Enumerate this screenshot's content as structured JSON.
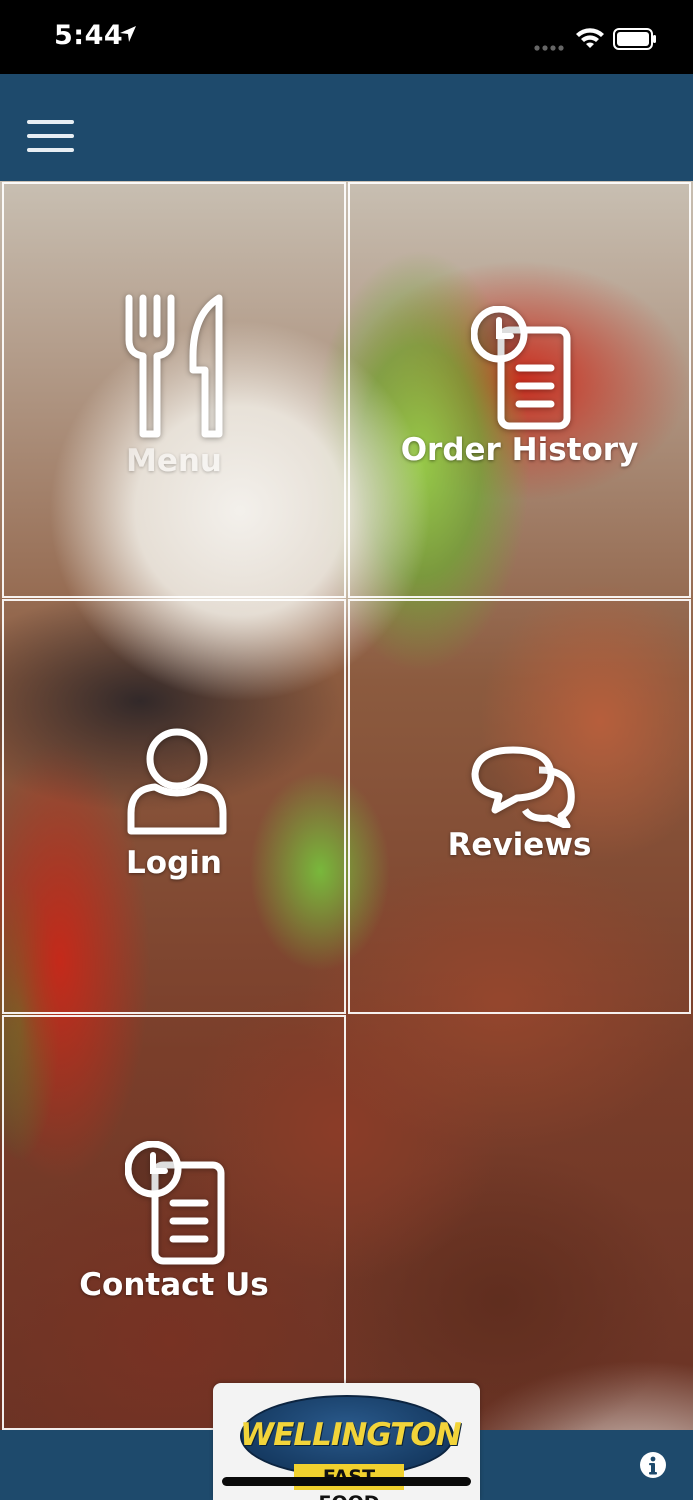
{
  "status_bar": {
    "time": "5:44"
  },
  "header": {
    "menu_icon": "hamburger-icon"
  },
  "tiles": [
    {
      "label": "Menu",
      "icon": "fork-knife-icon"
    },
    {
      "label": "Order History",
      "icon": "clock-document-icon"
    },
    {
      "label": "Login",
      "icon": "user-icon"
    },
    {
      "label": "Reviews",
      "icon": "chat-bubbles-icon"
    },
    {
      "label": "Contact Us",
      "icon": "clock-document-icon"
    }
  ],
  "footer": {
    "logo": {
      "name": "WELLINGTON",
      "sub": "FAST FOOD"
    },
    "info_icon": "info-icon"
  },
  "colors": {
    "nav_bar": "#1e4a6c",
    "status_bar": "#000000",
    "tile_border": "#ffffff",
    "logo_yellow": "#f2d43a",
    "logo_blue": "#163b63"
  }
}
